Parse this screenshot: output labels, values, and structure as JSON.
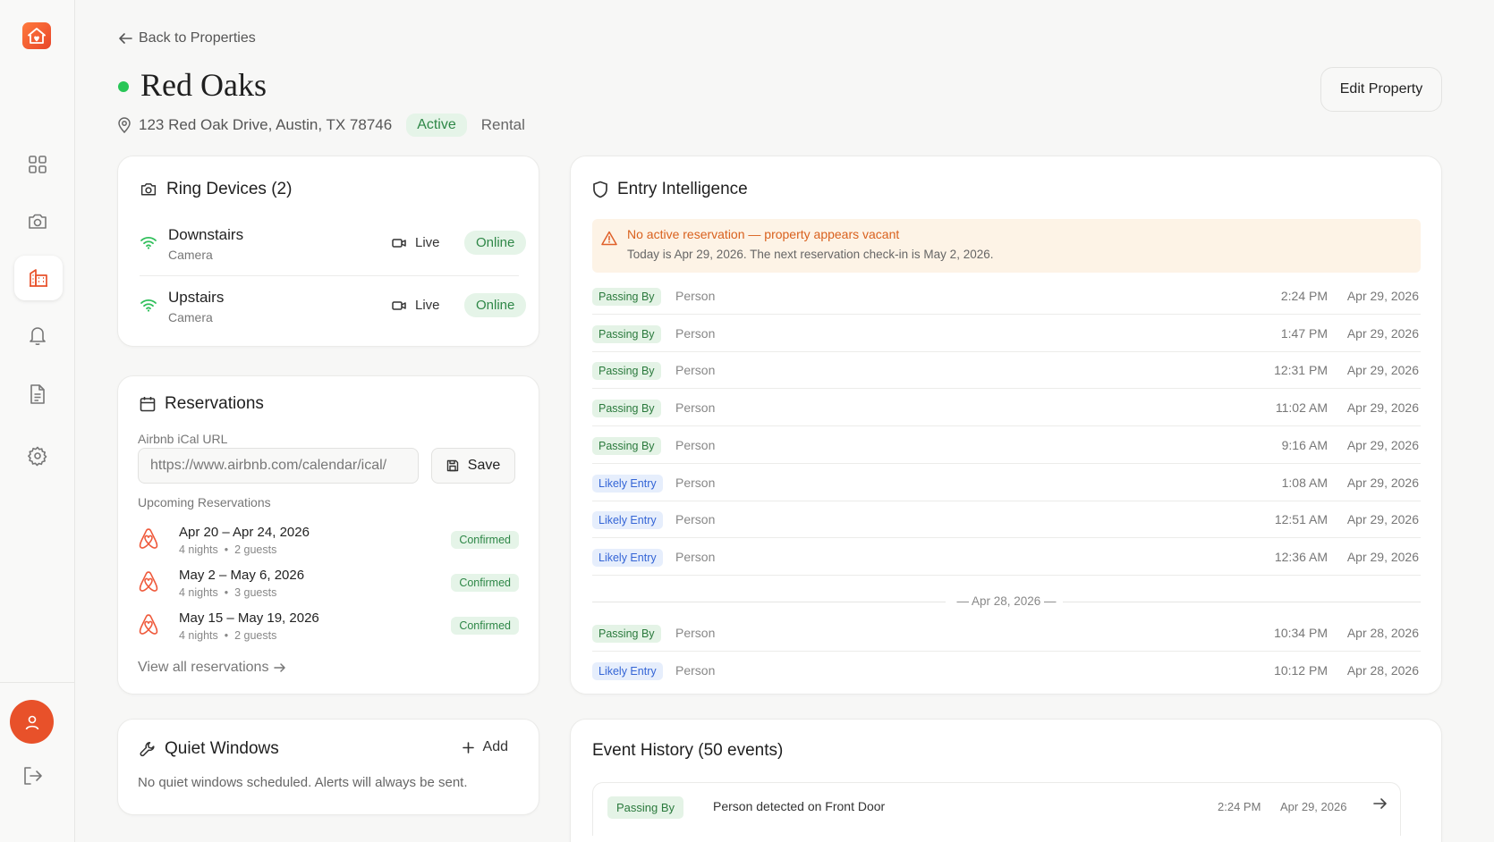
{
  "nav": {
    "items": [
      {
        "icon": "dashboard-grid-icon"
      },
      {
        "icon": "camera-icon"
      },
      {
        "icon": "building-icon"
      },
      {
        "icon": "bell-icon"
      },
      {
        "icon": "document-icon"
      },
      {
        "icon": "gear-icon"
      }
    ],
    "active_index": 2
  },
  "header": {
    "back_label": "Back to Properties",
    "property_name": "Red Oaks",
    "address": "123 Red Oak Drive, Austin, TX 78746",
    "status": "Active",
    "type": "Rental",
    "edit_label": "Edit Property",
    "status_color": "#28c657"
  },
  "ring": {
    "title": "Ring Devices (2)",
    "devices": [
      {
        "name": "Downstairs",
        "type": "Camera",
        "live": "Live",
        "status": "Online"
      },
      {
        "name": "Upstairs",
        "type": "Camera",
        "live": "Live",
        "status": "Online"
      }
    ]
  },
  "reservations": {
    "title": "Reservations",
    "ical_label": "Airbnb iCal URL",
    "ical_value": "https://www.airbnb.com/calendar/ical/",
    "save_label": "Save",
    "upcoming_label": "Upcoming Reservations",
    "items": [
      {
        "dates": "Apr 20 – Apr 24, 2026",
        "nights": "4 nights",
        "guests": "2 guests",
        "status": "Confirmed"
      },
      {
        "dates": "May 2 – May 6, 2026",
        "nights": "4 nights",
        "guests": "3 guests",
        "status": "Confirmed"
      },
      {
        "dates": "May 15 – May 19, 2026",
        "nights": "4 nights",
        "guests": "2 guests",
        "status": "Confirmed"
      }
    ],
    "view_all_label": "View all reservations"
  },
  "quiet": {
    "title": "Quiet Windows",
    "add_label": "Add",
    "empty_text": "No quiet windows scheduled. Alerts will always be sent."
  },
  "entry": {
    "title": "Entry Intelligence",
    "alert_title": "No active reservation — property appears vacant",
    "alert_sub": "Today is Apr 29, 2026. The next reservation check-in is May 2, 2026.",
    "events": [
      {
        "tag": "Passing By",
        "kind": "pass",
        "type": "Person",
        "time": "2:24 PM",
        "date": "Apr 29, 2026"
      },
      {
        "tag": "Passing By",
        "kind": "pass",
        "type": "Person",
        "time": "1:47 PM",
        "date": "Apr 29, 2026"
      },
      {
        "tag": "Passing By",
        "kind": "pass",
        "type": "Person",
        "time": "12:31 PM",
        "date": "Apr 29, 2026"
      },
      {
        "tag": "Passing By",
        "kind": "pass",
        "type": "Person",
        "time": "11:02 AM",
        "date": "Apr 29, 2026"
      },
      {
        "tag": "Passing By",
        "kind": "pass",
        "type": "Person",
        "time": "9:16 AM",
        "date": "Apr 29, 2026"
      },
      {
        "tag": "Likely Entry",
        "kind": "likely",
        "type": "Person",
        "time": "1:08 AM",
        "date": "Apr 29, 2026"
      },
      {
        "tag": "Likely Entry",
        "kind": "likely",
        "type": "Person",
        "time": "12:51 AM",
        "date": "Apr 29, 2026"
      },
      {
        "tag": "Likely Entry",
        "kind": "likely",
        "type": "Person",
        "time": "12:36 AM",
        "date": "Apr 29, 2026"
      }
    ],
    "separator": "— Apr 28, 2026 —",
    "events_after": [
      {
        "tag": "Passing By",
        "kind": "pass",
        "type": "Person",
        "time": "10:34 PM",
        "date": "Apr 28, 2026"
      },
      {
        "tag": "Likely Entry",
        "kind": "likely",
        "type": "Person",
        "time": "10:12 PM",
        "date": "Apr 28, 2026"
      }
    ]
  },
  "history": {
    "title": "Event History (50 events)",
    "first": {
      "tag": "Passing By",
      "desc": "Person detected on Front Door",
      "time": "2:24 PM",
      "date": "Apr 29, 2026"
    }
  }
}
